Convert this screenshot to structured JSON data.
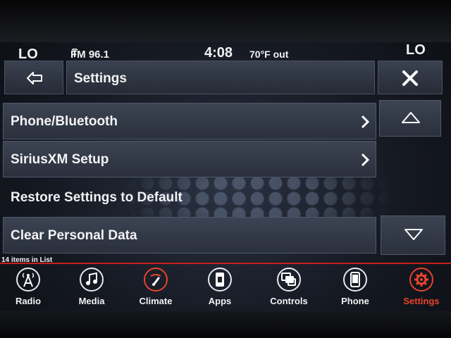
{
  "status_bar": {
    "temp_left": "LO",
    "radio": "FM 96.1",
    "time": "4:08",
    "outside_temp": "70°F out",
    "temp_right": "LO"
  },
  "header": {
    "title": "Settings"
  },
  "list": {
    "items": [
      {
        "label": "Phone/Bluetooth"
      },
      {
        "label": "SiriusXM Setup"
      },
      {
        "label": "Restore Settings to Default"
      },
      {
        "label": "Clear Personal Data"
      }
    ],
    "count_text": "14 items in List"
  },
  "nav": {
    "items": [
      {
        "label": "Radio",
        "icon": "radio-tower-icon"
      },
      {
        "label": "Media",
        "icon": "music-note-icon"
      },
      {
        "label": "Climate",
        "icon": "climate-icon"
      },
      {
        "label": "Apps",
        "icon": "apps-icon"
      },
      {
        "label": "Controls",
        "icon": "controls-icon"
      },
      {
        "label": "Phone",
        "icon": "phone-icon"
      },
      {
        "label": "Settings",
        "icon": "gear-icon"
      }
    ],
    "active": "Settings"
  },
  "colors": {
    "accent": "#e8432c",
    "divider": "#c8201a",
    "button": "#2f3541"
  }
}
